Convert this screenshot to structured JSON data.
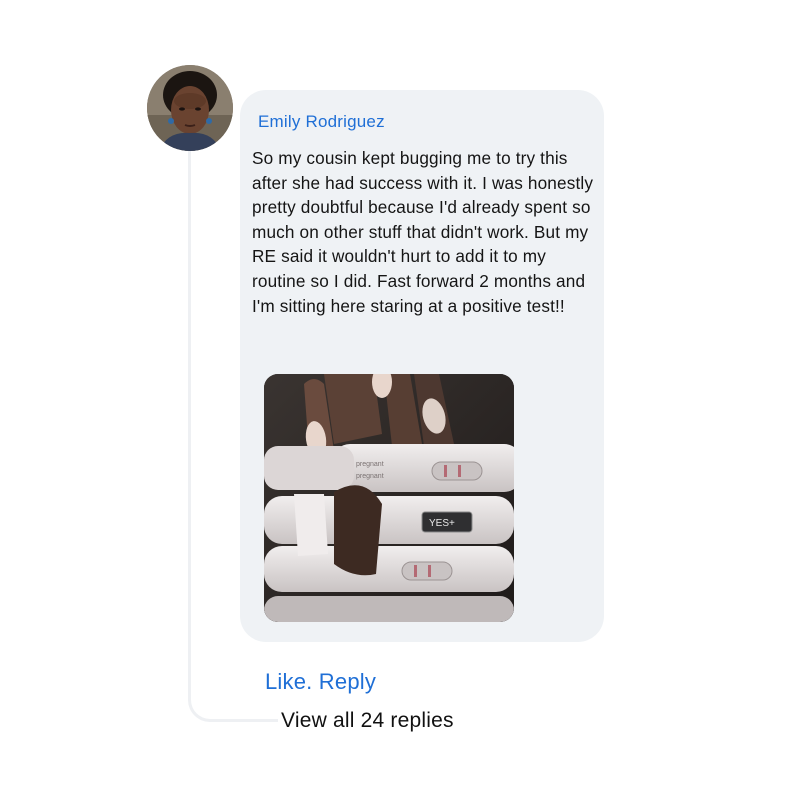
{
  "comment": {
    "author": "Emily Rodriguez",
    "text": "So my cousin kept bugging me to try this after she had success with it. I was honestly pretty doubtful because I'd already spent so much on other stuff that didn't work. But my RE said it wouldn't hurt to add it to my routine so I did. Fast forward 2 months and I'm sitting here staring at a positive test!!",
    "photo": {
      "test_labels": [
        "pregnant",
        "pregnant"
      ],
      "result_window_text": "YES+"
    }
  },
  "actions": {
    "like": "Like.",
    "reply": "Reply"
  },
  "replies": {
    "view_all": "View all 24 replies"
  },
  "colors": {
    "accent": "#1f6fd6",
    "bubble": "#eff2f5",
    "thread_line": "#eef0f3",
    "text": "#151515"
  }
}
